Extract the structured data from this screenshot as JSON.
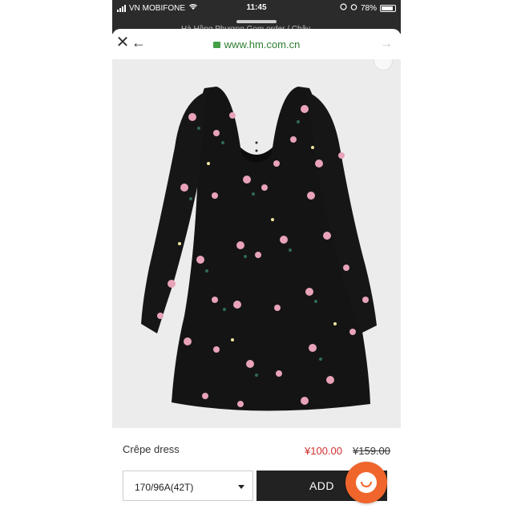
{
  "status_bar": {
    "carrier": "VN MOBIFONE",
    "time": "11:45",
    "battery": "78%"
  },
  "background_tab": {
    "text": "Hà Hồng Phượng  Gom order / Chây"
  },
  "browser": {
    "url": "www.hm.com.cn",
    "close_icon": "close-icon",
    "back_icon": "back-arrow-icon",
    "forward_icon": "forward-arrow-icon",
    "lock_icon": "lock-icon",
    "accent": "#2e7d32"
  },
  "product": {
    "name": "Crêpe dress",
    "sale_price": "¥100.00",
    "old_price": "¥159.00",
    "sale_color": "#d32f2f",
    "size_selected": "170/96A(42T)",
    "add_label": "ADD"
  },
  "chat": {
    "icon": "chat-face-icon",
    "color": "#f0652c"
  }
}
